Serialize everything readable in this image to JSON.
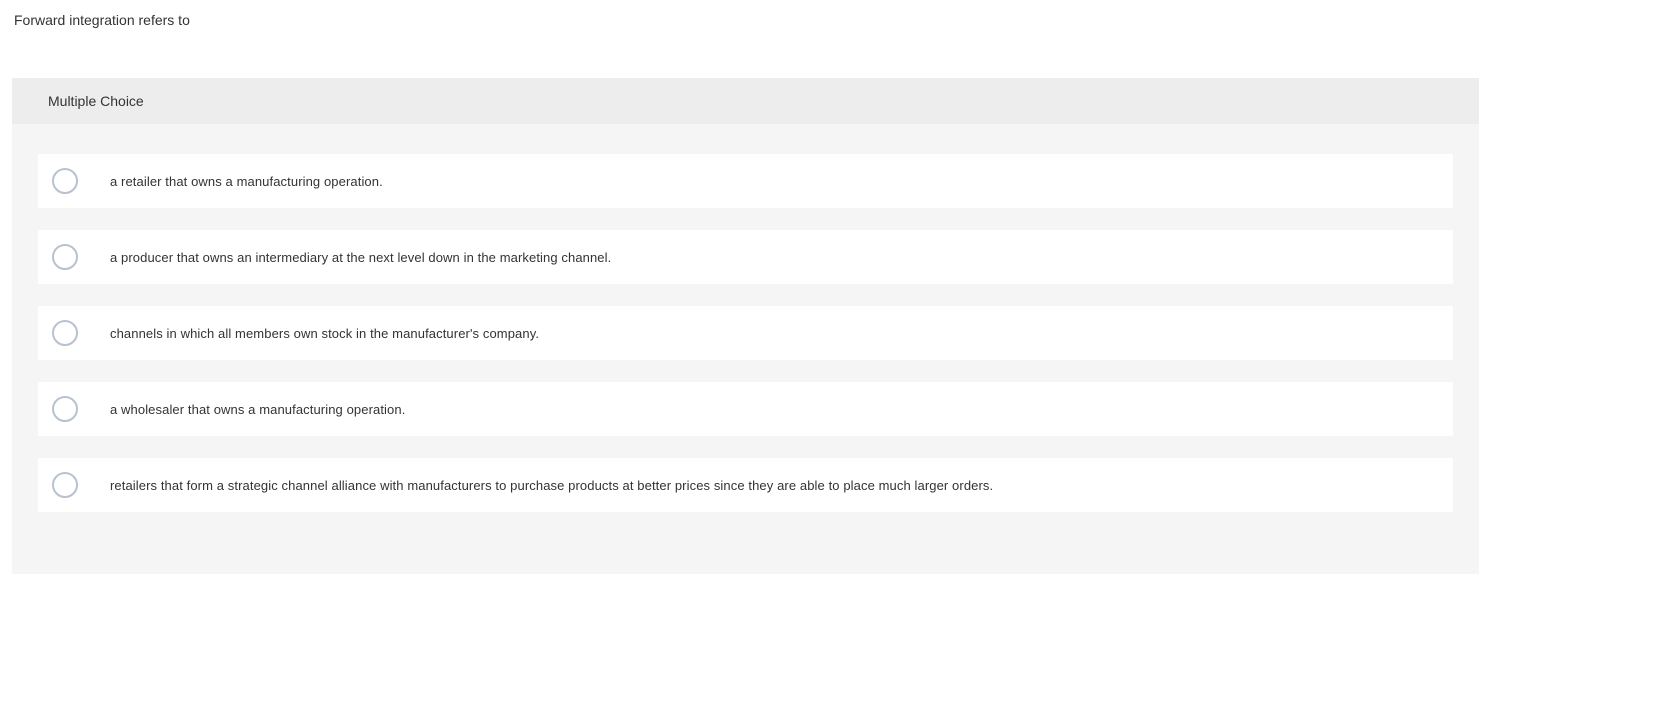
{
  "question": {
    "text": "Forward integration refers to"
  },
  "mc": {
    "header": "Multiple Choice",
    "options": [
      {
        "text": "a retailer that owns a manufacturing operation."
      },
      {
        "text": "a producer that owns an intermediary at the next level down in the marketing channel."
      },
      {
        "text": "channels in which all members own stock in the manufacturer's company."
      },
      {
        "text": "a wholesaler that owns a manufacturing operation."
      },
      {
        "text": "retailers that form a strategic channel alliance with manufacturers to purchase products at better prices since they are able to place much larger orders."
      }
    ]
  }
}
